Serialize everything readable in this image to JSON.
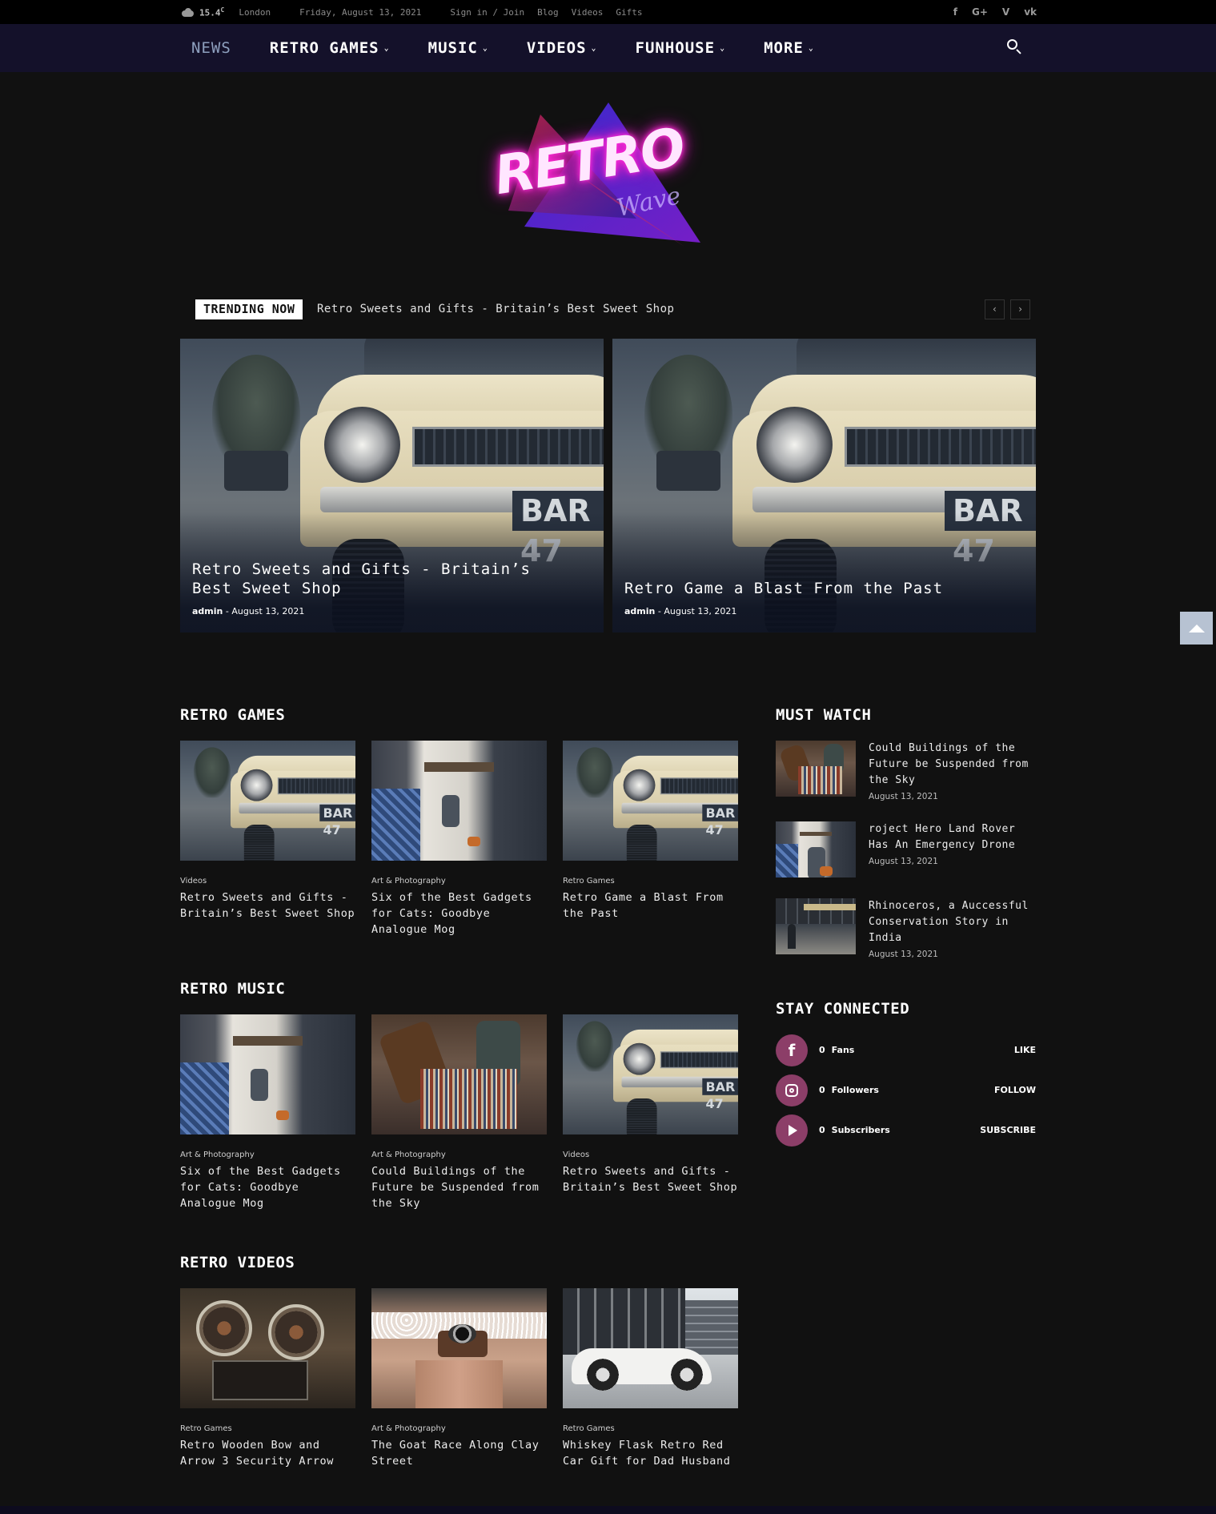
{
  "topbar": {
    "temperature": "15.4",
    "temp_unit": "C",
    "city": "London",
    "date": "Friday, August 13, 2021",
    "links": [
      "Sign in / Join",
      "Blog",
      "Videos",
      "Gifts"
    ],
    "social": [
      {
        "icon": "facebook-icon",
        "glyph": "f"
      },
      {
        "icon": "google-plus-icon",
        "glyph": "G+"
      },
      {
        "icon": "vimeo-icon",
        "glyph": "V"
      },
      {
        "icon": "vk-icon",
        "glyph": "vk"
      }
    ]
  },
  "nav": {
    "items": [
      "NEWS",
      "RETRO GAMES",
      "MUSIC",
      "VIDEOS",
      "FUNHOUSE",
      "MORE"
    ],
    "chevron": "⌄"
  },
  "logo": {
    "main": "RETRO",
    "sub": "Wave"
  },
  "trending": {
    "label": "TRENDING NOW",
    "headline": "Retro Sweets and Gifts - Britain’s Best Sweet Shop",
    "prev": "‹",
    "next": "›"
  },
  "hero": [
    {
      "title": "Retro Sweets and Gifts - Britain’s Best Sweet Shop",
      "author": "admin",
      "sep": "-",
      "date": "August 13, 2021"
    },
    {
      "title": "Retro Game a Blast From the Past",
      "author": "admin",
      "sep": "-",
      "date": "August 13, 2021"
    }
  ],
  "sections": [
    {
      "title": "RETRO GAMES",
      "cards": [
        {
          "category": "Videos",
          "title": "Retro Sweets and Gifts - Britain’s Best Sweet Shop"
        },
        {
          "category": "Art & Photography",
          "title": "Six of the Best Gadgets for Cats: Goodbye Analogue Mog"
        },
        {
          "category": "Retro Games",
          "title": "Retro Game a Blast From the Past"
        }
      ]
    },
    {
      "title": "RETRO MUSIC",
      "cards": [
        {
          "category": "Art & Photography",
          "title": "Six of the Best Gadgets for Cats: Goodbye Analogue Mog"
        },
        {
          "category": "Art & Photography",
          "title": "Could Buildings of the Future be Suspended from the Sky"
        },
        {
          "category": "Videos",
          "title": "Retro Sweets and Gifts - Britain’s Best Sweet Shop"
        }
      ]
    },
    {
      "title": "RETRO VIDEOS",
      "cards": [
        {
          "category": "Retro Games",
          "title": "Retro Wooden Bow and Arrow 3 Security Arrow"
        },
        {
          "category": "Art & Photography",
          "title": "The Goat Race Along Clay Street"
        },
        {
          "category": "Retro Games",
          "title": "Whiskey Flask Retro Red Car Gift for Dad Husband"
        }
      ]
    }
  ],
  "must_watch": {
    "title": "MUST WATCH",
    "items": [
      {
        "title": "Could Buildings of the Future be Suspended from the Sky",
        "date": "August 13, 2021"
      },
      {
        "title": "roject Hero Land Rover Has An Emergency Drone",
        "date": "August 13, 2021"
      },
      {
        "title": "Rhinoceros, a Auccessful Conservation Story in India",
        "date": "August 13, 2021"
      }
    ]
  },
  "stay_connected": {
    "title": "STAY CONNECTED",
    "rows": [
      {
        "icon": "facebook-icon",
        "count": "0",
        "label": "Fans",
        "action": "LIKE"
      },
      {
        "icon": "instagram-icon",
        "count": "0",
        "label": "Followers",
        "action": "FOLLOW"
      },
      {
        "icon": "youtube-icon",
        "count": "0",
        "label": "Subscribers",
        "action": "SUBSCRIBE"
      }
    ]
  },
  "plate_text": "BAR 47",
  "colors": {
    "background": "#111111",
    "nav_background": "#14112a",
    "accent_social": "#8c3e68",
    "scroll_top": "#b7c2d2"
  }
}
